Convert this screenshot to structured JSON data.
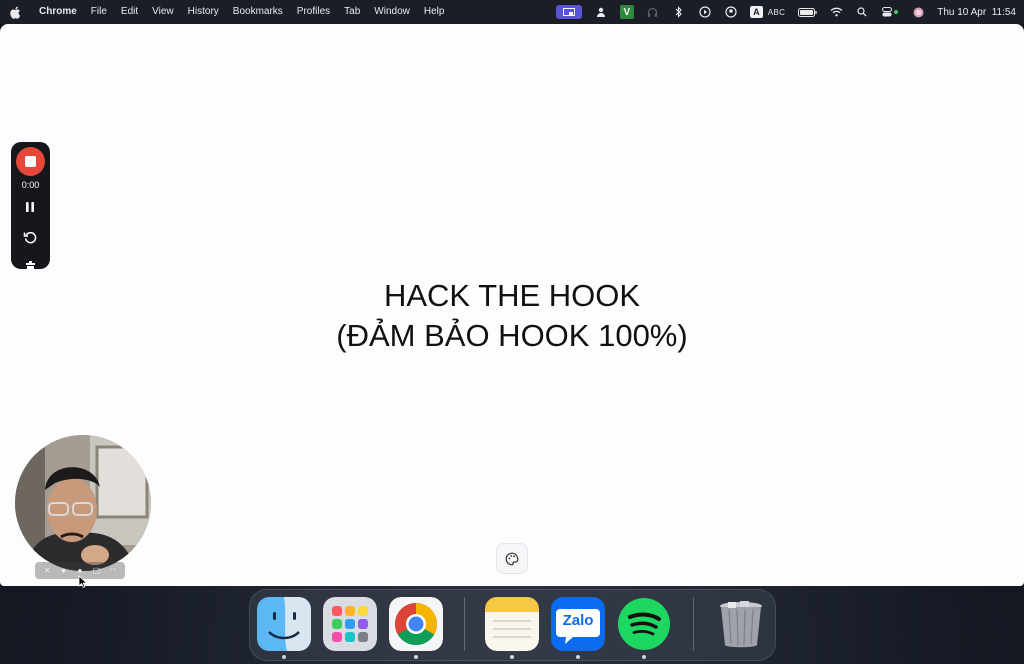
{
  "menubar": {
    "app_name": "Chrome",
    "menus": [
      "File",
      "Edit",
      "View",
      "History",
      "Bookmarks",
      "Profiles",
      "Tab",
      "Window",
      "Help"
    ],
    "v_badge": "V",
    "input_badge": "A",
    "input_source": "ABC",
    "clock": "Thu 10 Apr  11:54"
  },
  "slide": {
    "line1": "HACK THE HOOK",
    "line2": "(ĐẢM BẢO HOOK 100%)"
  },
  "recorder": {
    "timer": "0:00"
  },
  "dock": {
    "apps": [
      "Finder",
      "Launchpad",
      "Google Chrome",
      "Notes",
      "Zalo",
      "Spotify",
      "Trash"
    ],
    "zalo_label": "Zalo"
  },
  "colors": {
    "menubar": "#1b1e26",
    "page": "#fdfcfe",
    "record_red": "#e5483a",
    "screen_share_purple": "#5a55d6",
    "spotify_green": "#1ed760",
    "zalo_blue": "#0b6cf0"
  }
}
